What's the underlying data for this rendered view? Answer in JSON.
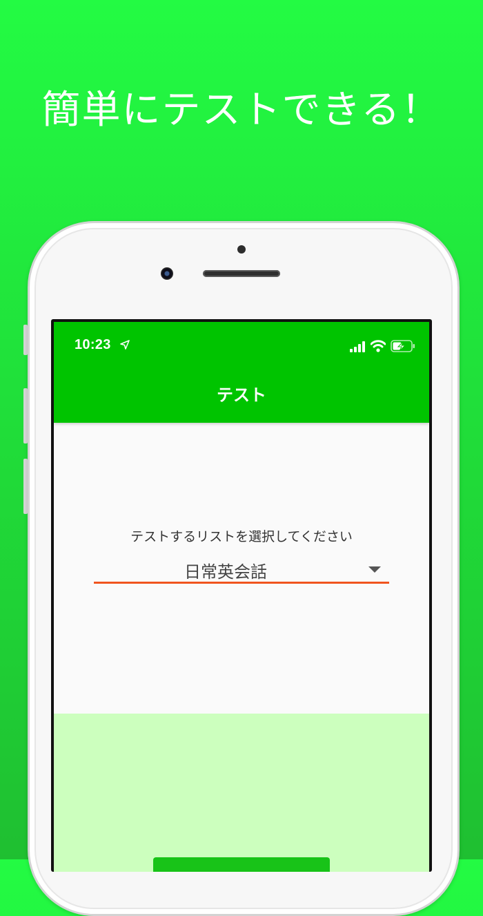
{
  "promo": {
    "headline": "簡単にテストできる！"
  },
  "status_bar": {
    "time": "10:23",
    "location_icon": "location-arrow-icon",
    "signal_icon": "cellular-signal-icon",
    "wifi_icon": "wifi-icon",
    "battery_icon": "battery-charging-icon"
  },
  "app_bar": {
    "title": "テスト"
  },
  "test_select": {
    "label": "テストするリストを選択してください",
    "selected_value": "日常英会話",
    "arrow_icon": "dropdown-arrow-icon"
  },
  "colors": {
    "background": "#22f444",
    "app_bar": "#00c400",
    "underline": "#f0541e",
    "bottom_panel": "#ccffbe",
    "start_button": "#18c318"
  }
}
